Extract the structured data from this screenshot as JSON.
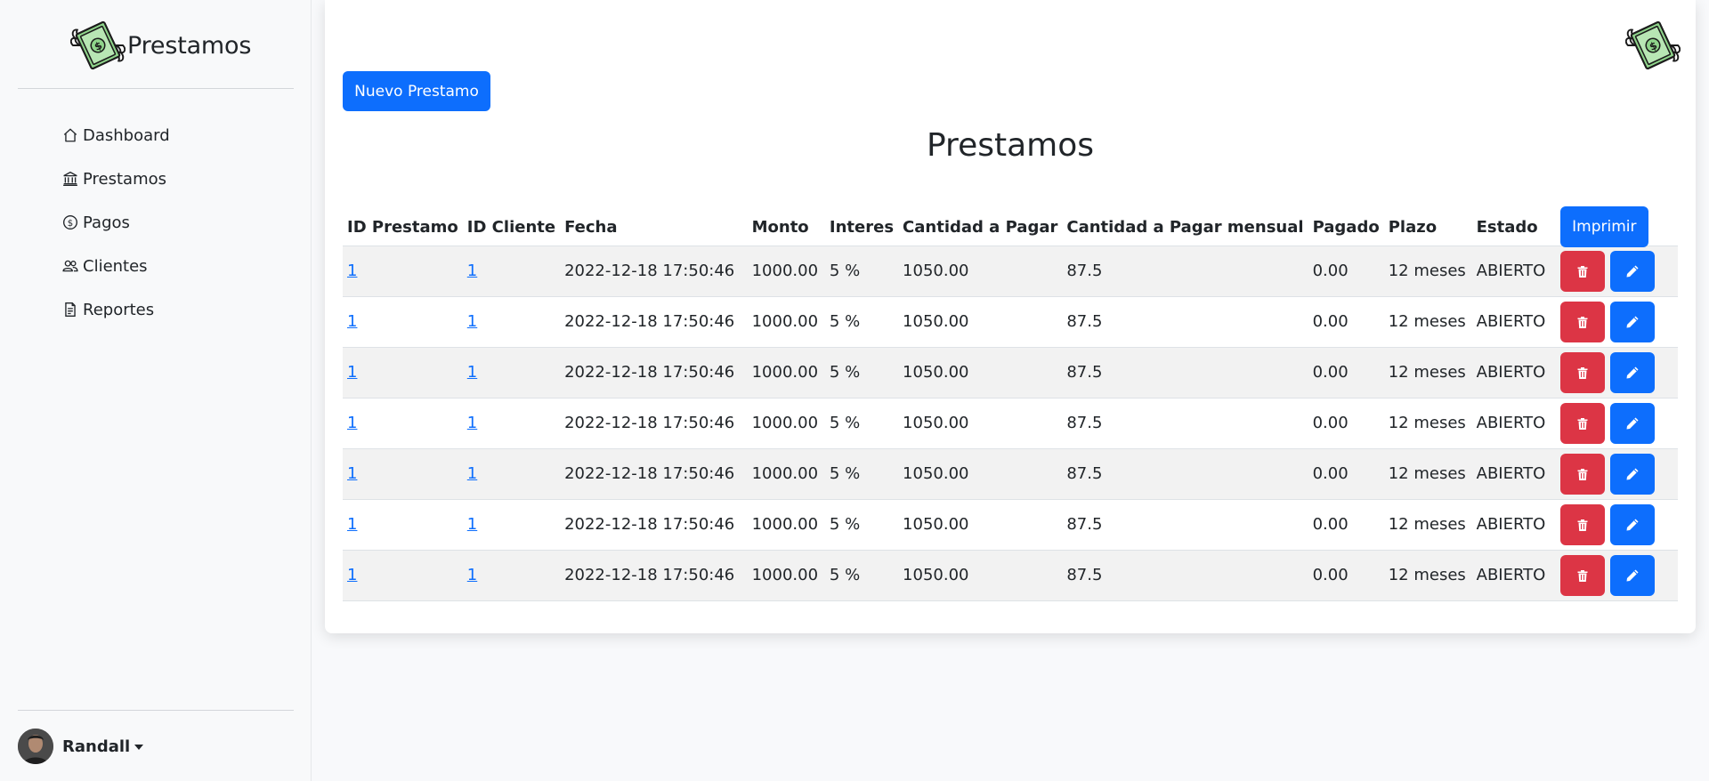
{
  "app": {
    "brand_name": "Prestamos"
  },
  "sidebar": {
    "items": [
      {
        "label": "Dashboard",
        "icon": "house-icon"
      },
      {
        "label": "Prestamos",
        "icon": "bank-icon"
      },
      {
        "label": "Pagos",
        "icon": "dollar-circle-icon"
      },
      {
        "label": "Clientes",
        "icon": "people-icon"
      },
      {
        "label": "Reportes",
        "icon": "file-text-icon"
      }
    ],
    "user": {
      "name": "Randall"
    }
  },
  "main": {
    "new_button_label": "Nuevo Prestamo",
    "title": "Prestamos",
    "print_button_label": "Imprimir",
    "table": {
      "headers": [
        "ID Prestamo",
        "ID Cliente",
        "Fecha",
        "Monto",
        "Interes",
        "Cantidad a Pagar",
        "Cantidad a Pagar mensual",
        "Pagado",
        "Plazo",
        "Estado"
      ],
      "rows": [
        {
          "id_prestamo": "1",
          "id_cliente": "1",
          "fecha": "2022-12-18 17:50:46",
          "monto": "1000.00",
          "interes": "5 %",
          "cantidad": "1050.00",
          "mensual": "87.5",
          "pagado": "0.00",
          "plazo": "12 meses",
          "estado": "ABIERTO"
        },
        {
          "id_prestamo": "1",
          "id_cliente": "1",
          "fecha": "2022-12-18 17:50:46",
          "monto": "1000.00",
          "interes": "5 %",
          "cantidad": "1050.00",
          "mensual": "87.5",
          "pagado": "0.00",
          "plazo": "12 meses",
          "estado": "ABIERTO"
        },
        {
          "id_prestamo": "1",
          "id_cliente": "1",
          "fecha": "2022-12-18 17:50:46",
          "monto": "1000.00",
          "interes": "5 %",
          "cantidad": "1050.00",
          "mensual": "87.5",
          "pagado": "0.00",
          "plazo": "12 meses",
          "estado": "ABIERTO"
        },
        {
          "id_prestamo": "1",
          "id_cliente": "1",
          "fecha": "2022-12-18 17:50:46",
          "monto": "1000.00",
          "interes": "5 %",
          "cantidad": "1050.00",
          "mensual": "87.5",
          "pagado": "0.00",
          "plazo": "12 meses",
          "estado": "ABIERTO"
        },
        {
          "id_prestamo": "1",
          "id_cliente": "1",
          "fecha": "2022-12-18 17:50:46",
          "monto": "1000.00",
          "interes": "5 %",
          "cantidad": "1050.00",
          "mensual": "87.5",
          "pagado": "0.00",
          "plazo": "12 meses",
          "estado": "ABIERTO"
        },
        {
          "id_prestamo": "1",
          "id_cliente": "1",
          "fecha": "2022-12-18 17:50:46",
          "monto": "1000.00",
          "interes": "5 %",
          "cantidad": "1050.00",
          "mensual": "87.5",
          "pagado": "0.00",
          "plazo": "12 meses",
          "estado": "ABIERTO"
        },
        {
          "id_prestamo": "1",
          "id_cliente": "1",
          "fecha": "2022-12-18 17:50:46",
          "monto": "1000.00",
          "interes": "5 %",
          "cantidad": "1050.00",
          "mensual": "87.5",
          "pagado": "0.00",
          "plazo": "12 meses",
          "estado": "ABIERTO"
        }
      ]
    }
  },
  "colors": {
    "primary": "#0d6efd",
    "danger": "#dc3545",
    "stripe": "#f2f2f2"
  }
}
